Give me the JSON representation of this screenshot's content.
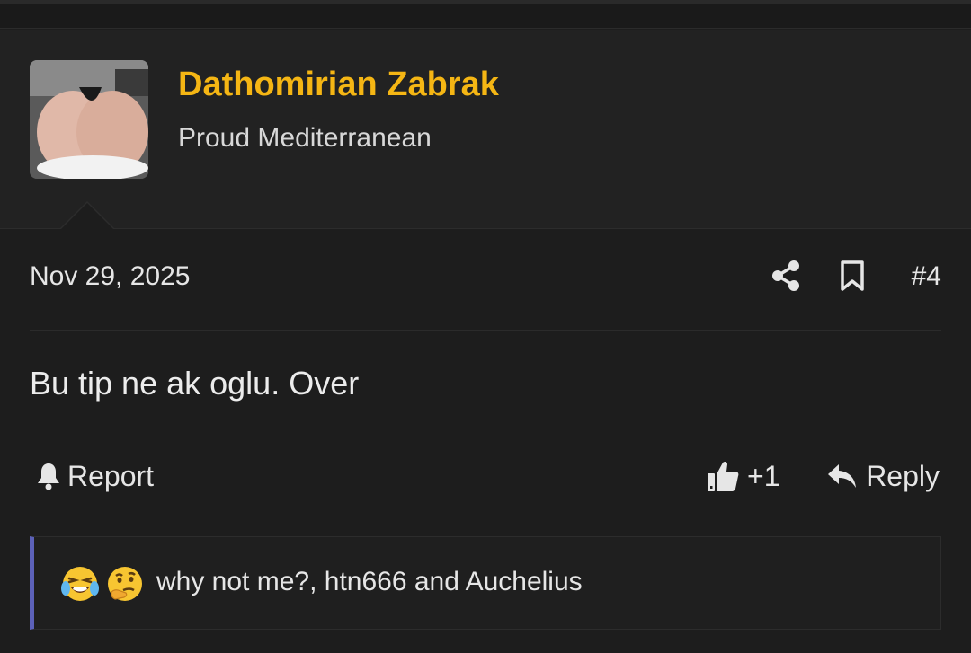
{
  "post": {
    "username": "Dathomirian Zabrak",
    "user_title": "Proud Mediterranean",
    "date": "Nov 29, 2025",
    "post_number": "#4",
    "message": "Bu tip ne ak oglu. Over"
  },
  "actions": {
    "report_label": "Report",
    "like_label": "+1",
    "reply_label": "Reply"
  },
  "reactions": {
    "emojis": [
      "laughing-crying-emoji",
      "thinking-emoji"
    ],
    "text": "why not me?, htn666 and Auchelius"
  },
  "colors": {
    "username": "#f5b614",
    "reaction_accent": "#5c61b8",
    "background": "#1d1d1d"
  }
}
